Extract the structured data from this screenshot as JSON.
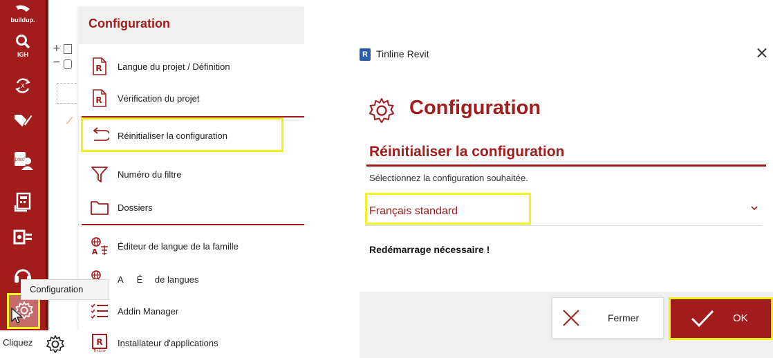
{
  "toolbar": {
    "logo_label": "buildup.",
    "search_label": "IGH",
    "items": [
      "logo",
      "search",
      "sync",
      "tag-edit",
      "dwg-user",
      "calculator-doc",
      "list-doc",
      "support",
      "settings"
    ]
  },
  "tree": {
    "plus": "+",
    "minus": "−"
  },
  "tooltip": {
    "text": "Configuration"
  },
  "status": {
    "text": "Cliquez"
  },
  "menu": {
    "title": "Configuration",
    "items": [
      {
        "label": "Langue du projet / Définition",
        "icon": "r-doc-icon"
      },
      {
        "label": "Vérification du projet",
        "icon": "r-doc-icon"
      },
      {
        "label": "Réinitialiser la configuration",
        "icon": "undo-arrow-icon"
      },
      {
        "label": "Numéro du filtre",
        "icon": "filter-icon"
      },
      {
        "label": "Dossiers",
        "icon": "folder-icon"
      },
      {
        "label": "Éditeur de langue de la famille",
        "icon": "translate-icon"
      },
      {
        "label_left": "A",
        "label_mid": "É",
        "label_right": "de langues",
        "icon": "translate-icon"
      },
      {
        "label": "Addin Manager",
        "icon": "list-icon"
      },
      {
        "label": "Installateur d'applications",
        "icon": "r-box-icon"
      }
    ],
    "icon_letter": "R",
    "icon_small": "TinLine"
  },
  "dialog": {
    "app_icon_letter": "R",
    "app_title": "Tinline Revit",
    "close_symbol": "×",
    "heading": "Configuration",
    "subheading": "Réinitialiser la configuration",
    "description": "Sélectionnez la configuration souhaitée.",
    "selected_value": "Français standard",
    "restart_notice": "Redémarrage nécessaire !",
    "close_button": "Fermer",
    "ok_button": "OK"
  },
  "colors": {
    "accent": "#a31c1c",
    "highlight": "#f2f21e",
    "active_toolbar": "#c76a6a"
  }
}
